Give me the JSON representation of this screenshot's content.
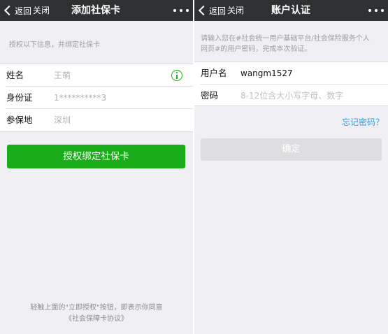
{
  "left": {
    "nav": {
      "back_label": "返回",
      "close_label": "关闭",
      "title": "添加社保卡"
    },
    "hint": "授权以下信息，并绑定社保卡",
    "rows": [
      {
        "label": "姓名",
        "value": "王萌"
      },
      {
        "label": "身份证",
        "value": "1**********3"
      },
      {
        "label": "参保地",
        "value": "深圳"
      }
    ],
    "primary_button": "授权绑定社保卡",
    "footer": {
      "line1": "轻触上面的\"立即授权\"按钮，即表示你同意",
      "line2": "《社会保障卡协议》"
    }
  },
  "right": {
    "nav": {
      "back_label": "返回",
      "close_label": "关闭",
      "title": "账户认证"
    },
    "hint_line1": "请输入您在#社会统一用户基础平台/社会保险服务个人",
    "hint_line2": "网页#的用户密码，完成本次验证。",
    "username": {
      "label": "用户名",
      "value": "wangm1527"
    },
    "password": {
      "label": "密码",
      "placeholder": "8-12位含大小写字母、数字"
    },
    "forgot_link": "忘记密码？",
    "confirm_button": "确定"
  },
  "colors": {
    "topbar": "#2e3132",
    "primary_green": "#1aad19",
    "link_blue": "#3b9bd2",
    "background": "#efeff4"
  }
}
